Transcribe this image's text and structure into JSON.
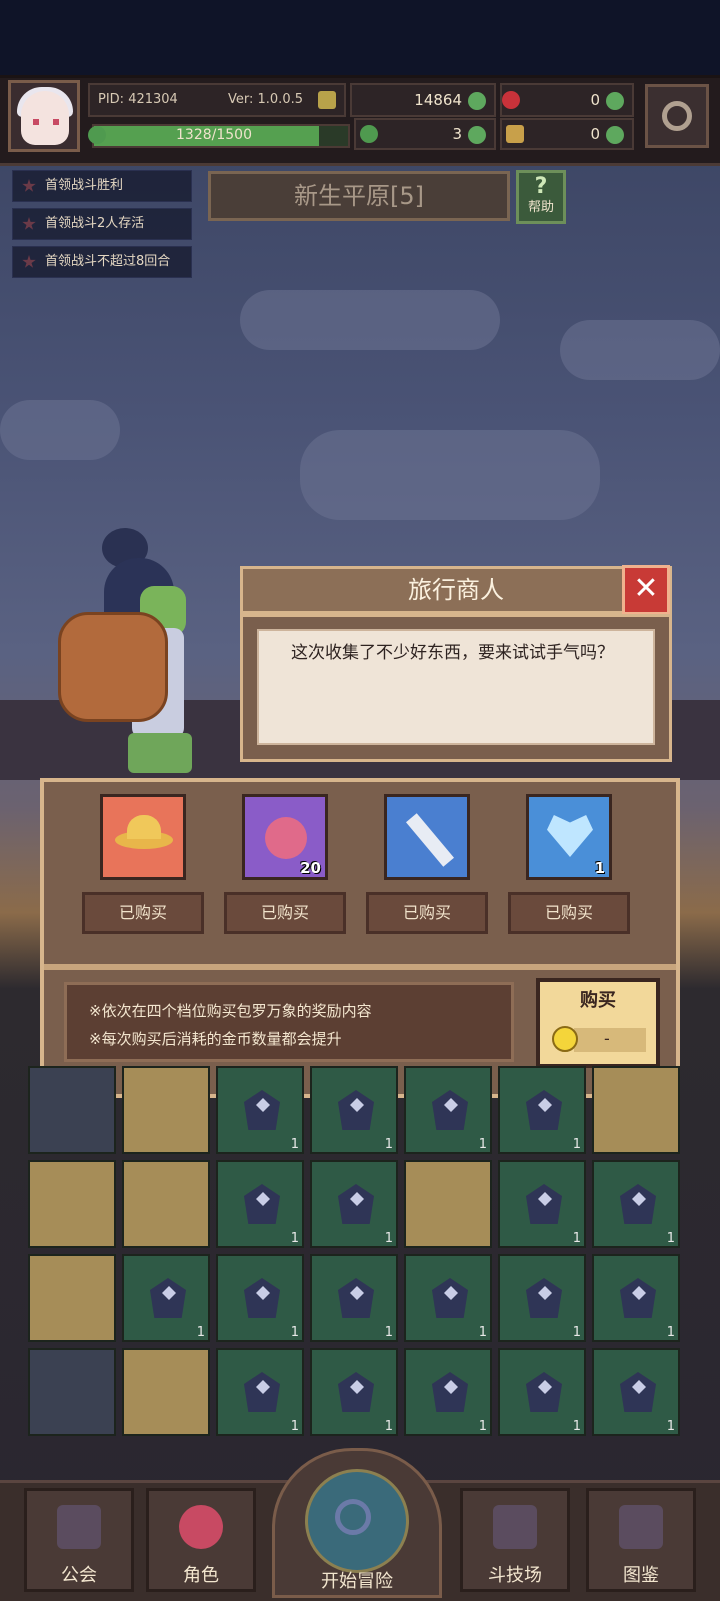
{
  "player": {
    "pid": "PID: 421304",
    "version": "Ver: 1.0.0.5",
    "hp": "1328/1500",
    "hp_fraction": 0.885
  },
  "resources": {
    "gold": "14864",
    "gem": "0",
    "clover": "3",
    "key": "0"
  },
  "quests": [
    "首领战斗胜利",
    "首领战斗2人存活",
    "首领战斗不超过8回合"
  ],
  "area": {
    "name": "新生平原[5]",
    "help_label": "帮助",
    "help_icon": "?"
  },
  "dialog": {
    "title": "旅行商人",
    "close_label": "✕",
    "text": "这次收集了不少好东西，要来试试手气吗？"
  },
  "shop": {
    "items": [
      {
        "icon": "straw-hat-icon",
        "qty": "",
        "status": "已购买"
      },
      {
        "icon": "peach-fruit-icon",
        "qty": "20",
        "status": "已购买"
      },
      {
        "icon": "sword-icon",
        "qty": "",
        "status": "已购买"
      },
      {
        "icon": "heart-gem-icon",
        "qty": "1",
        "status": "已购买"
      }
    ],
    "note_1": "※依次在四个档位购买包罗万象的奖励内容",
    "note_2": "※每次购买后消耗的金币数量都会提升",
    "buy_label": "购买",
    "price": "-"
  },
  "grid": {
    "tile_qty": "1"
  },
  "nav": {
    "guild": "公会",
    "character": "角色",
    "adventure": "开始冒险",
    "arena": "斗技场",
    "codex": "图鉴"
  },
  "colors": {
    "accent": "#d7b58c",
    "panel": "#7a5f4d",
    "close": "#c83a36",
    "buy": "#f2d89a"
  }
}
